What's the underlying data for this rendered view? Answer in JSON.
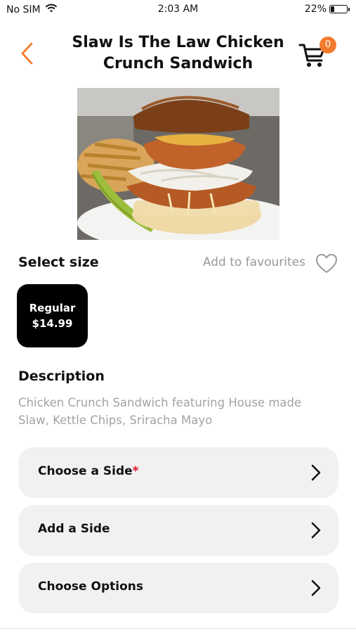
{
  "status_bar": {
    "carrier": "No SIM",
    "time": "2:03 AM",
    "battery_percent": "22%",
    "battery_level": 0.22
  },
  "header": {
    "back_icon": "chevron-left-icon",
    "title": "Slaw Is The Law Chicken Crunch Sandwich",
    "cart_icon": "cart-icon",
    "cart_count": "0"
  },
  "product_image": {
    "description": "sandwich-with-fries-and-pickle"
  },
  "size_section": {
    "label": "Select size",
    "favourite_label": "Add to favourites",
    "favourite_icon": "heart-outline-icon",
    "sizes": [
      {
        "name": "Regular",
        "price": "$14.99",
        "selected": true
      }
    ]
  },
  "description": {
    "heading": "Description",
    "text": "Chicken Crunch Sandwich featuring House made Slaw, Kettle Chips, Sriracha Mayo"
  },
  "options": [
    {
      "label": "Choose a Side",
      "required": true,
      "required_mark": "*"
    },
    {
      "label": "Add a Side",
      "required": false
    },
    {
      "label": "Choose Options",
      "required": false
    }
  ],
  "colors": {
    "accent": "#f47b2e",
    "required": "#e0102a",
    "selected_size_bg": "#000000",
    "option_bg": "#f1f1f1"
  }
}
